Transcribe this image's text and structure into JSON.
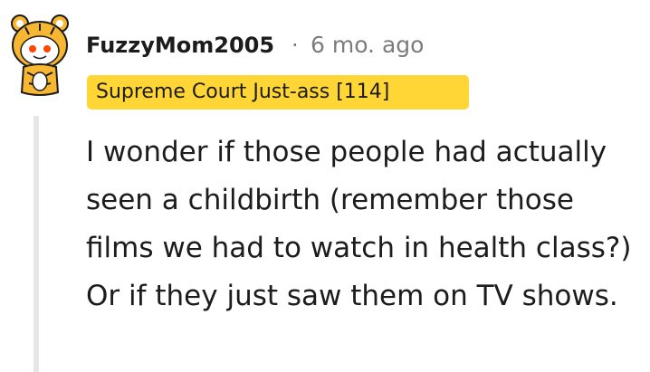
{
  "comment": {
    "author": "FuzzyMom2005",
    "separator": "·",
    "time_ago": "6 mo. ago",
    "flair": "Supreme Court Just-ass [114]",
    "body": "I wonder if those people had actually seen a childbirth (remember those films we had to watch in health class?) Or if they just saw them on TV shows."
  },
  "icons": {
    "avatar": "snoo-avatar-tiger-costume"
  },
  "colors": {
    "flair_background": "#ffd635",
    "meta_text": "#7c7c7c",
    "thread_line": "#e6e6e6",
    "text": "#1c1c1c"
  }
}
